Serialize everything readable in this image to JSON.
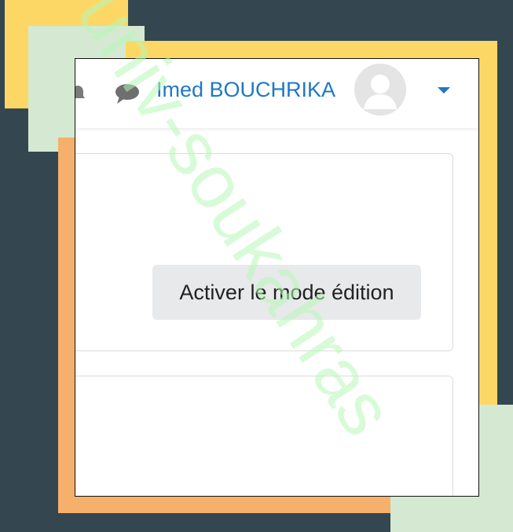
{
  "header": {
    "user_name": "Imed BOUCHRIKA",
    "icons": {
      "notifications": "bell-icon",
      "messages": "chat-icon",
      "avatar": "user-avatar",
      "menu": "caret-down-icon"
    }
  },
  "main": {
    "edit_mode_button": "Activer le mode édition"
  },
  "watermark": {
    "text": "univ-soukahras"
  },
  "colors": {
    "background": "#344751",
    "accent_yellow": "#fdd766",
    "accent_orange": "#f5b06b",
    "accent_green": "#d5e9d2",
    "link_blue": "#1f78c4",
    "button_gray": "#e8e9ea",
    "watermark_green": "#b6f7b6"
  }
}
